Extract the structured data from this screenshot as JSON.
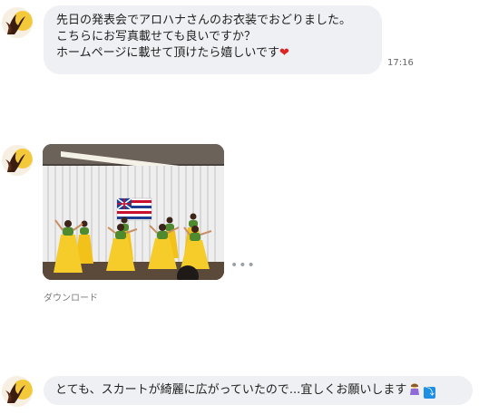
{
  "messages": [
    {
      "lines": [
        "先日の発表会でアロハナさんのお衣装でおどりました。",
        "こちらにお写真載せても良いですか？",
        "ホームページに載せて頂けたら嬉しいです"
      ],
      "emoji": "heart-emoji",
      "time": "17:16"
    },
    {
      "image": "hula-dancers-photo",
      "more": "•••",
      "download_label": "ダウンロード"
    },
    {
      "text": "とても、スカートが綺麗に広がっていたので...宜しくお願いします",
      "emoji": "person-bowing-emoji",
      "badge": "⤵"
    }
  ],
  "colors": {
    "bubble": "#eef0f3",
    "heart": "#e02424",
    "skirt": "#f2c21b",
    "badge": "#1f8fe6"
  }
}
